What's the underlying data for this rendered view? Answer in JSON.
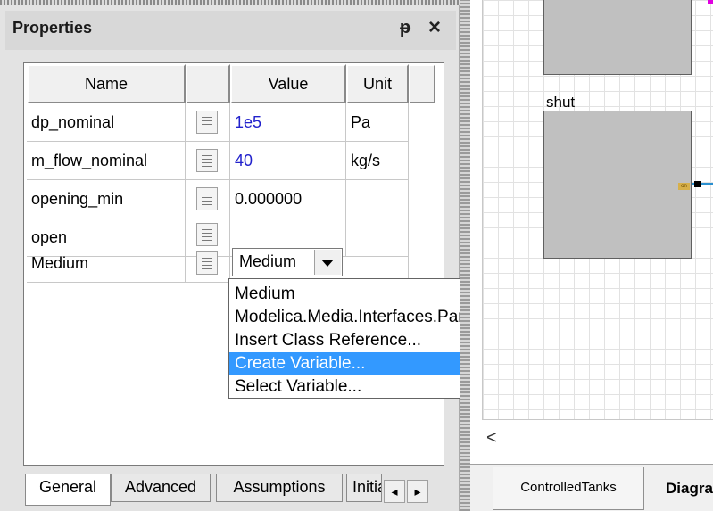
{
  "panel": {
    "title": "Properties",
    "pin_glyph": "ᵽ",
    "close_glyph": "×",
    "columns": [
      "Name",
      "",
      "Value",
      "Unit",
      ""
    ],
    "rows": [
      {
        "name": "dp_nominal",
        "value": "1e5",
        "unit": "Pa"
      },
      {
        "name": "m_flow_nominal",
        "value": "40",
        "unit": "kg/s"
      },
      {
        "name": "opening_min",
        "value": "0.000000",
        "unit": ""
      },
      {
        "name": "open",
        "value": "",
        "unit": ""
      },
      {
        "name": "Medium",
        "value": "",
        "unit": ""
      }
    ],
    "medium_combo": {
      "selected": "Medium"
    },
    "dropdown_options": [
      "Medium",
      "Modelica.Media.Interfaces.PartialMedium",
      "Insert Class Reference...",
      "Create Variable...",
      "Select Variable..."
    ],
    "highlighted_option": "Create Variable...",
    "tabs": [
      "General",
      "Advanced",
      "Assumptions",
      "Initia"
    ],
    "active_tab": "General",
    "tab_scroll_left": "◂",
    "tab_scroll_right": "▸"
  },
  "diagram": {
    "component_label": "shut",
    "port_tag": "on",
    "scroll_left_glyph": "<",
    "tabs": [
      "ControlledTanks",
      "Diagra"
    ],
    "colors": {
      "block": "#c0c0c0",
      "connector": "#2a90d0",
      "selection": "#3399ff"
    }
  }
}
